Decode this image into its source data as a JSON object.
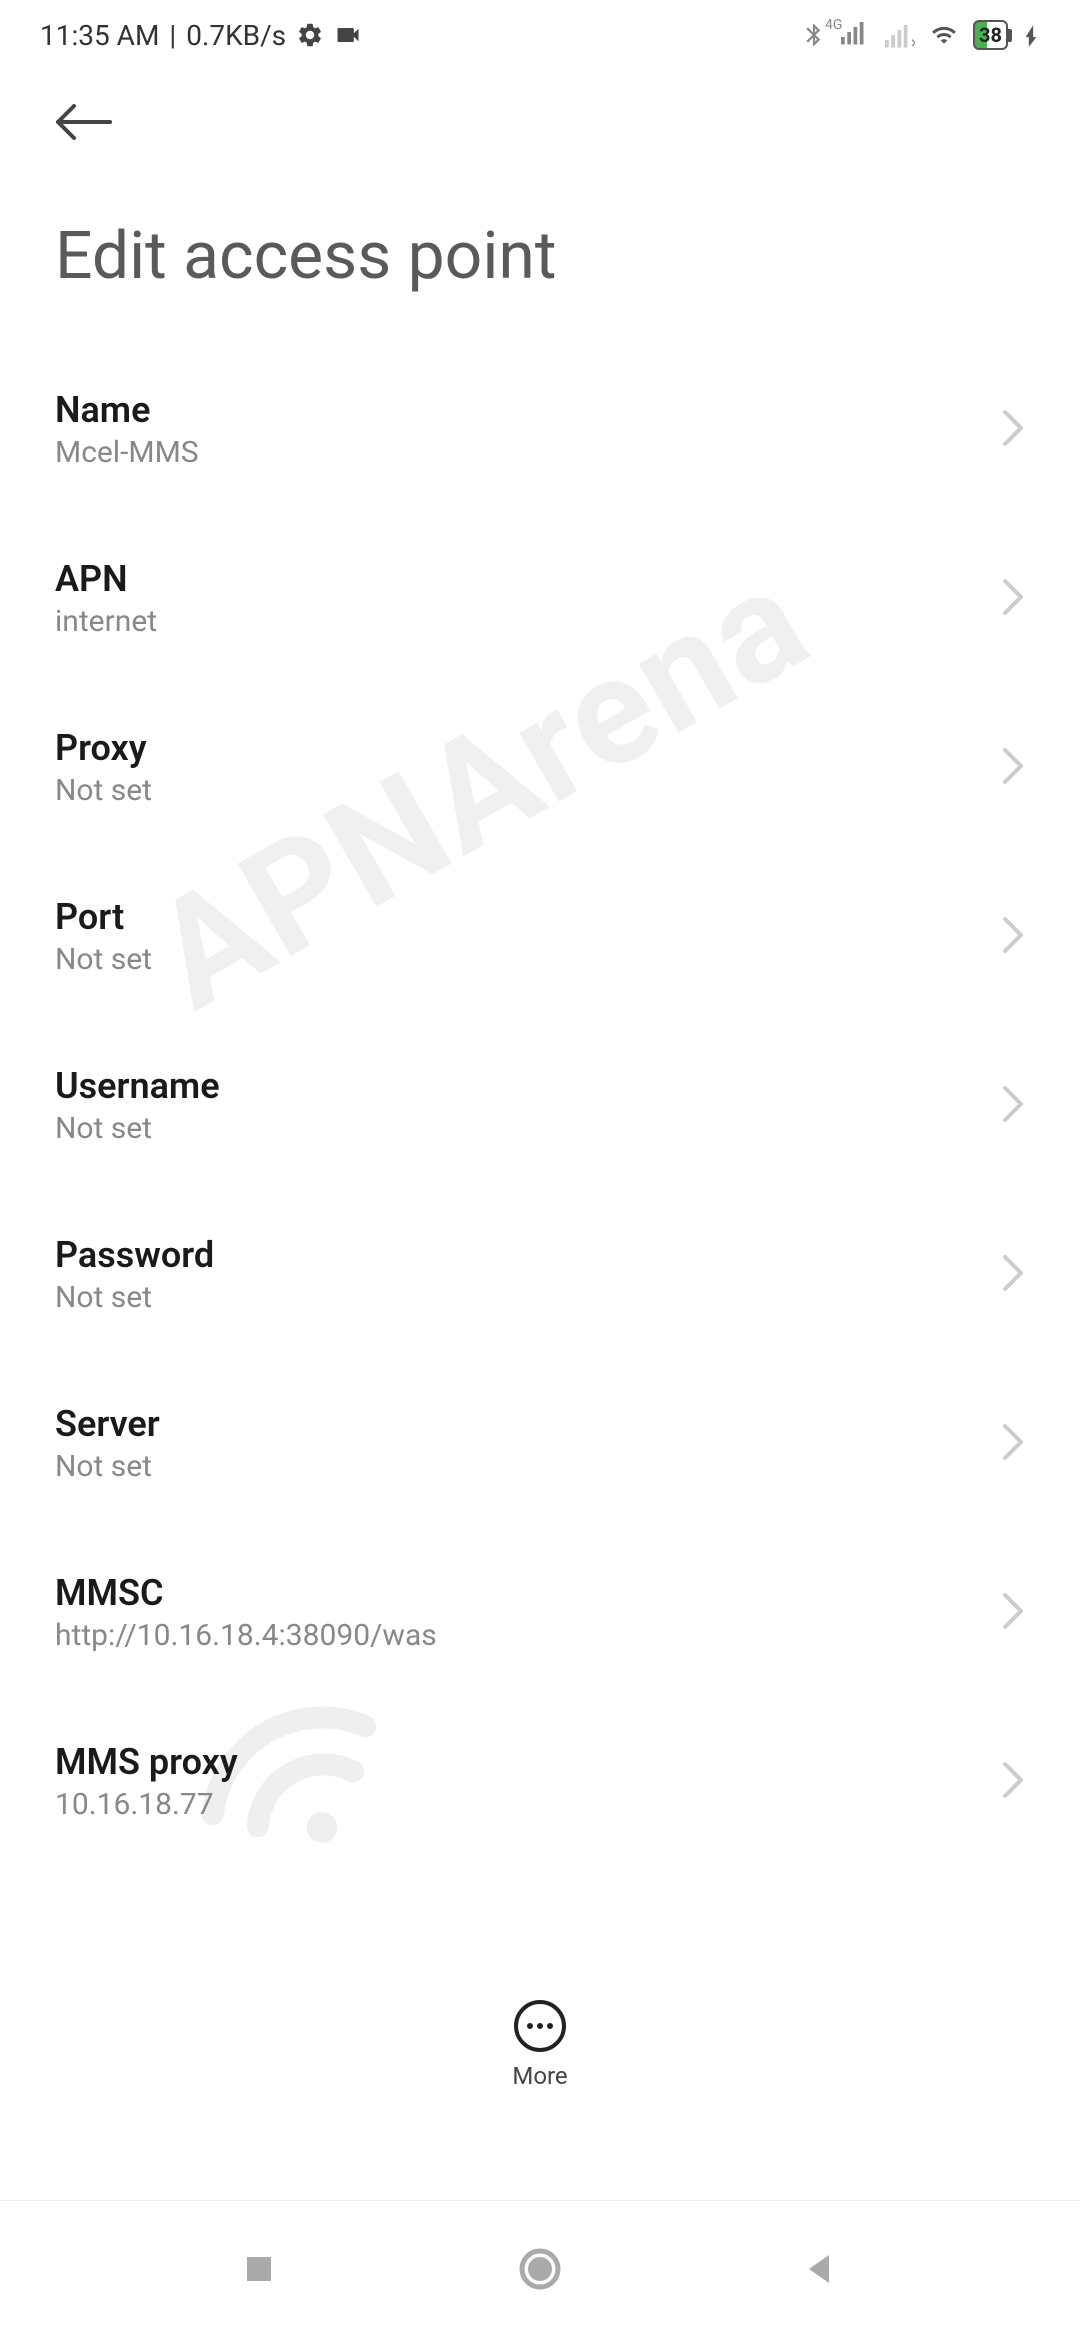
{
  "statusBar": {
    "time": "11:35 AM",
    "dataRate": "0.7KB/s",
    "networkType": "4G",
    "batteryPercent": "38"
  },
  "header": {
    "pageTitle": "Edit access point"
  },
  "items": [
    {
      "label": "Name",
      "value": "Mcel-MMS"
    },
    {
      "label": "APN",
      "value": "internet"
    },
    {
      "label": "Proxy",
      "value": "Not set"
    },
    {
      "label": "Port",
      "value": "Not set"
    },
    {
      "label": "Username",
      "value": "Not set"
    },
    {
      "label": "Password",
      "value": "Not set"
    },
    {
      "label": "Server",
      "value": "Not set"
    },
    {
      "label": "MMSC",
      "value": "http://10.16.18.4:38090/was"
    },
    {
      "label": "MMS proxy",
      "value": "10.16.18.77"
    }
  ],
  "moreMenu": {
    "label": "More"
  },
  "watermark": "APNArena"
}
